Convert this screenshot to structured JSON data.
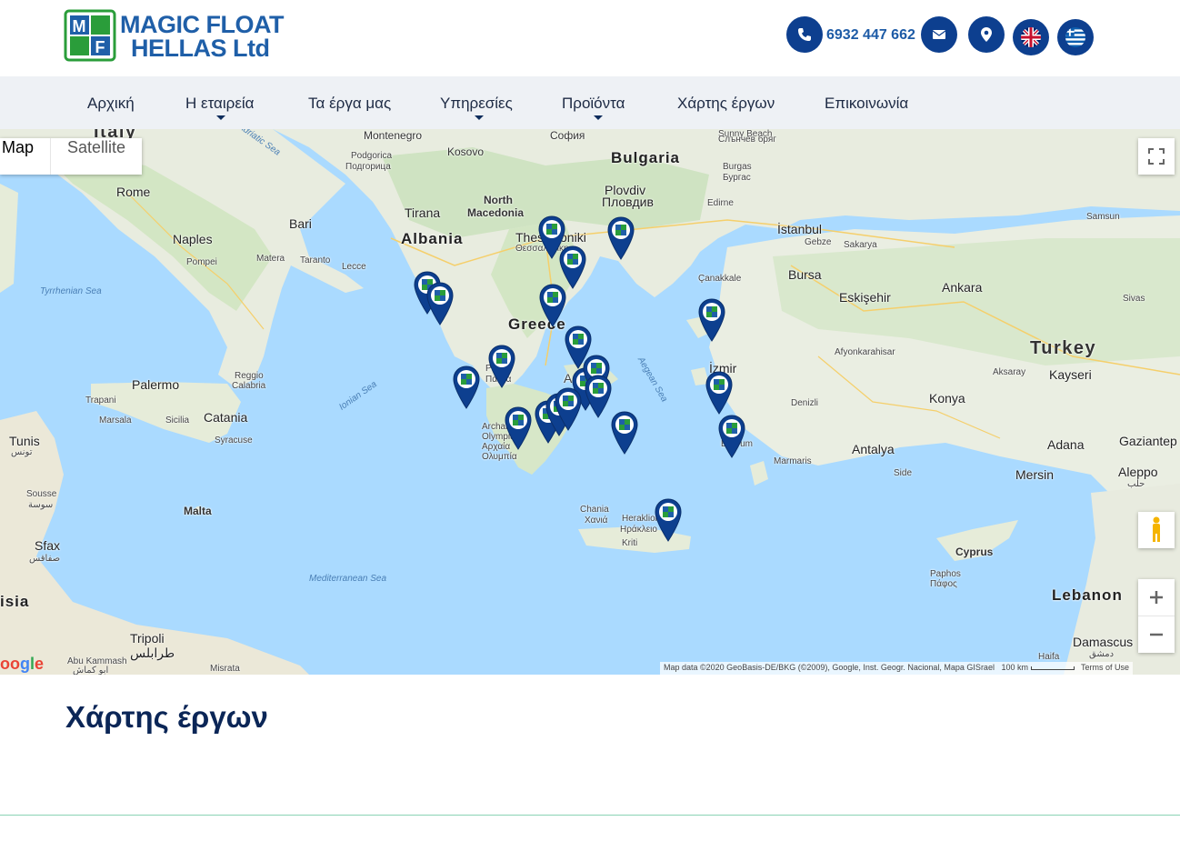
{
  "header": {
    "logo_line1": "MAGIC FLOAT",
    "logo_line2": "HELLAS Ltd",
    "phone": "6932 447 662",
    "icons": [
      "phone-icon",
      "envelope-icon",
      "map-marker-icon",
      "uk-flag-icon",
      "greek-flag-icon"
    ]
  },
  "nav": {
    "items": [
      {
        "label": "Αρχική",
        "dropdown": false
      },
      {
        "label": "Η εταιρεία",
        "dropdown": true
      },
      {
        "label": "Τα έργα μας",
        "dropdown": false
      },
      {
        "label": "Υπηρεσίες",
        "dropdown": true
      },
      {
        "label": "Προϊόντα",
        "dropdown": true
      },
      {
        "label": "Χάρτης έργων",
        "dropdown": false
      },
      {
        "label": "Επικοινωνία",
        "dropdown": false
      }
    ]
  },
  "map": {
    "type_controls": {
      "map": "Map",
      "satellite": "Satellite"
    },
    "attribution": "Map data ©2020 GeoBasis-DE/BKG (©2009), Google, Inst. Geogr. Nacional, Mapa GISrael",
    "scale": "100 km",
    "terms": "Terms of Use",
    "google": "Google",
    "labels": {
      "italy": "Italy",
      "montenegro": "Montenegro",
      "kosovo": "Kosovo",
      "sofia": "София",
      "bulgaria": "Bulgaria",
      "podgorica": "Podgorica",
      "podgorica_cyr": "Подгорица",
      "burgas": "Burgas",
      "burgas_cyr": "Бургас",
      "sunny_beach": "Sunny Beach",
      "sunny_beach_cyr": "Слънчев бряг",
      "rome": "Rome",
      "north_macedonia": "North\nMacedonia",
      "plovdiv": "Plovdiv",
      "plovdiv_cyr": "Пловдив",
      "edirne": "Edirne",
      "samsun": "Samsun",
      "bari": "Bari",
      "tirana": "Tirana",
      "istanbul": "İstanbul",
      "naples": "Naples",
      "albania": "Albania",
      "thessaloniki": "Thessaloniki",
      "thessaloniki_gr": "Θεσσαλονίκη",
      "gebze": "Gebze",
      "sakarya": "Sakarya",
      "pompei": "Pompei",
      "matera": "Matera",
      "taranto": "Taranto",
      "lecce": "Lecce",
      "canakkale": "Çanakkale",
      "bursa": "Bursa",
      "tyrrhenian": "Tyrrhenian Sea",
      "eskisehir": "Eskişehir",
      "ankara": "Ankara",
      "greece": "Greece",
      "sivas": "Sivas",
      "turkey": "Turkey",
      "afyon": "Afyonkarahisar",
      "izmir": "İzmir",
      "palermo": "Palermo",
      "reggio": "Reggio\nCalabria",
      "aksaray": "Aksaray",
      "kayseri": "Kayseri",
      "patras": "Patras",
      "patras_gr": "Πάτρα",
      "ionian": "Ionian Sea",
      "aegean": "Aegean Sea",
      "trapani": "Trapani",
      "marsala": "Marsala",
      "sicilia": "Sicilia",
      "catania": "Catania",
      "denizli": "Denizli",
      "konya": "Konya",
      "syracuse": "Syracuse",
      "archaia": "Archaia\nOlympia",
      "archaia_gr": "Αρχαία\nΟλυμπία",
      "tunis": "Tunis",
      "tunis_ar": "تونس",
      "adana": "Adana",
      "gaziantep": "Gaziantep",
      "bodrum": "Bodrum",
      "antalya": "Antalya",
      "marmaris": "Marmaris",
      "side": "Side",
      "mersin": "Mersin",
      "aleppo": "Aleppo",
      "aleppo_ar": "حلب",
      "sousse": "Sousse",
      "sousse_ar": "سوسة",
      "malta": "Malta",
      "chania": "Chania",
      "chania_gr": "Χανιά",
      "heraklion": "Heraklion",
      "heraklion_gr": "Ηράκλειο",
      "kriti": "Kriti",
      "sfax": "Sfax",
      "sfax_ar": "صفاقس",
      "cyprus": "Cyprus",
      "paphos": "Paphos",
      "paphos_gr": "Πάφος",
      "mediterranean": "Mediterranean Sea",
      "tunisia": "isia",
      "lebanon": "Lebanon",
      "tripoli": "Tripoli",
      "tripoli_ar": "طرابلس",
      "damascus": "Damascus",
      "damascus_ar": "دمشق",
      "bu_kammash": "Abu Kammash",
      "bu_kammash_ar": "ابو كماش",
      "misrata": "Misrata",
      "haifa": "Haifa",
      "athens_partial": "A"
    }
  },
  "page": {
    "title": "Χάρτης έργων"
  }
}
